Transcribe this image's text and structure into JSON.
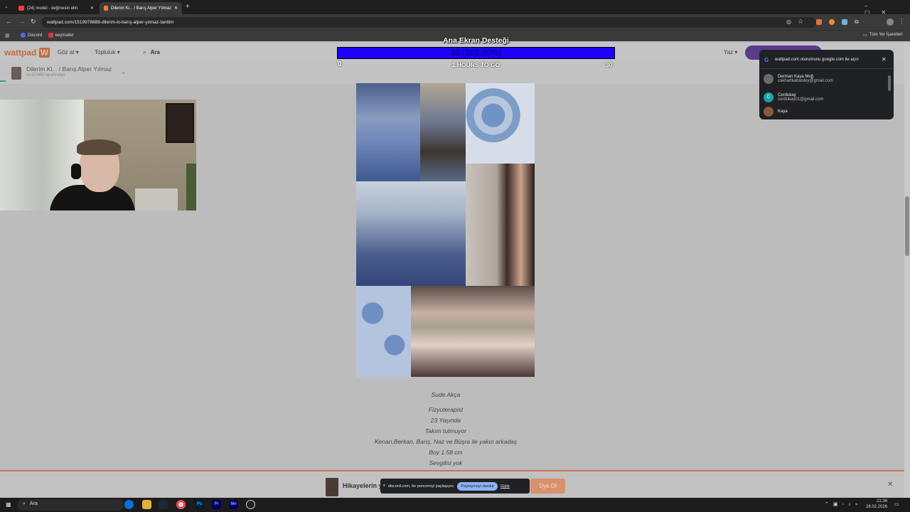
{
  "browser": {
    "tabs": [
      {
        "label": "(24) model - değmesin elin",
        "active": false,
        "color": "#ff3b3b"
      },
      {
        "label": "Dilerim Ki... / Barış Alper Yılmaz",
        "active": true,
        "color": "#ff7b3b"
      }
    ],
    "url": "wattpad.com/1519978888-dilerim-ki-barış-alper-yılmaz-tanitim",
    "bookmarks": [
      "Discord",
      "keymailer"
    ],
    "all_bookmarks": "Tüm Yer İşaretleri"
  },
  "wattpad": {
    "logo": "wattpad",
    "nav": [
      "Göz at",
      "Topluluk"
    ],
    "search": "Ara",
    "write": "Yaz",
    "story_title": "Dilerim Ki... / Barış Alper Yılmaz",
    "story_author": "inci27450 tarafından"
  },
  "goal": {
    "title": "Ana Ekran Desteği",
    "progress_text": "30 (100.00%)",
    "progress": 1.0,
    "min": "0",
    "remaining": "1 HOURS TO GO",
    "max": "30"
  },
  "google_popup": {
    "title": "wattpad.com oturumunu google.com ile açın",
    "accounts": [
      {
        "name": "Derman Kaya Muğ",
        "email": "cakhartkabardey@gmail.com",
        "avatar_color": "#6b6b6b",
        "initial": ""
      },
      {
        "name": "Cerdukay",
        "email": "cerdukay01@gmail.com",
        "avatar_color": "#1aa3a3",
        "initial": "C"
      },
      {
        "name": "Kaya",
        "email": "",
        "avatar_color": "#8a5a3a",
        "initial": ""
      }
    ]
  },
  "bio": [
    "Sude Akça",
    "Fizyoterapist",
    "23 Yaşında",
    "Takım tutmuyor",
    "Kenan,Berkan, Barış, Naz ve Büşra ile yakın arkadaş",
    "Boy 1.58 cm",
    "Sevgilisi yok"
  ],
  "banner": {
    "text": "Hikayelerin y",
    "join_button": "Üye Ol"
  },
  "share_bar": {
    "text": "discord.com, bir pencereyi paylaşıyor.",
    "stop_button": "Paylaşmayı durdur",
    "hide_link": "Gizle"
  },
  "taskbar": {
    "search": "Ara",
    "time": "21:36",
    "date": "28.02.2026",
    "apps": [
      "Ps",
      "Pr",
      "Me"
    ]
  },
  "colors": {
    "accent": "#c46a3a",
    "goal_bar": "#1e00ff",
    "taskbar": "#1c1c1c"
  }
}
